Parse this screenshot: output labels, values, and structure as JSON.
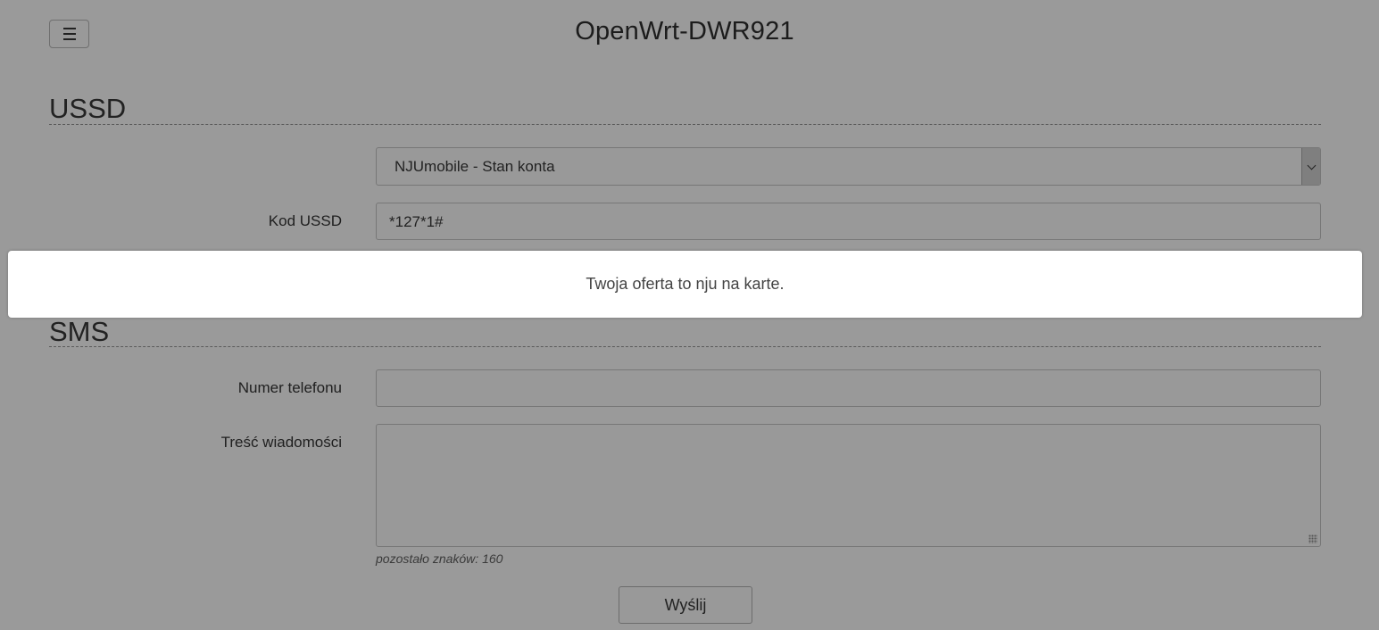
{
  "header": {
    "menu_icon": "hamburger-icon",
    "title": "OpenWrt-DWR921"
  },
  "ussd": {
    "section_title": "USSD",
    "preset_select": {
      "selected": "NJUmobile - Stan konta",
      "icon": "chevron-down-icon"
    },
    "code_label": "Kod USSD",
    "code_value": "*127*1#"
  },
  "notification": {
    "message": "Twoja oferta to nju na karte."
  },
  "sms": {
    "section_title": "SMS",
    "phone_label": "Numer telefonu",
    "phone_value": "",
    "message_label": "Treść wiadomości",
    "message_value": "",
    "remaining_hint": "pozostało znaków: 160",
    "send_label": "Wyślij"
  },
  "colors": {
    "overlay_background": "#9a9a9a",
    "toast_background": "#ffffff"
  }
}
